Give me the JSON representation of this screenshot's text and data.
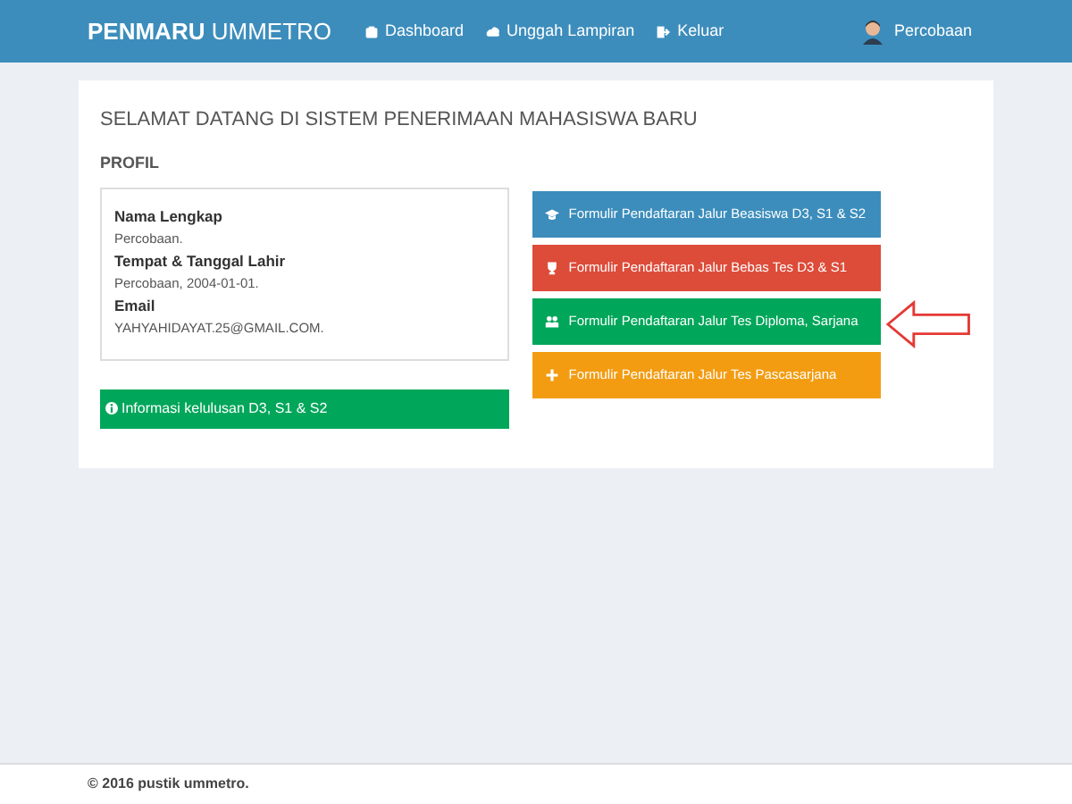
{
  "navbar": {
    "brand": "**PENMARU** UMMETRO",
    "links": [
      {
        "label": "Dashboard",
        "kind": "dashboard"
      },
      {
        "label": "Unggah Lampiran",
        "kind": "upload"
      },
      {
        "label": "Keluar",
        "kind": "logout"
      }
    ],
    "user": "Percobaan"
  },
  "welcome": "SELAMAT DATANG DI SISTEM PENERIMAAN MAHASISWA BARU",
  "profile": {
    "heading": "PROFIL",
    "fields": [
      {
        "label": "Nama Lengkap",
        "value": "Percobaan."
      },
      {
        "label": "Tempat & Tanggal Lahir",
        "value": "Percobaan, 2004-01-01."
      },
      {
        "label": "Email",
        "value": "YAHYAHIDAYAT.25@GMAIL.COM."
      }
    ]
  },
  "info_button": {
    "label": "Informasi kelulusan D3, S1 & S2",
    "color": "#00a65a"
  },
  "forms": [
    {
      "label": "Formulir Pendaftaran Jalur Beasiswa D3, S1 & S2",
      "kind": "graduation",
      "color": "#3c8dbc"
    },
    {
      "label": "Formulir Pendaftaran Jalur Bebas Tes D3 & S1",
      "kind": "trophy",
      "color": "#dd4b39"
    },
    {
      "label": "Formulir Pendaftaran Jalur Tes Diploma, Sarjana",
      "kind": "users",
      "color": "#00a65a"
    },
    {
      "label": "Formulir Pendaftaran Jalur Tes Pascasarjana",
      "kind": "plus",
      "color": "#f39c12"
    }
  ],
  "footer": "© 2016 pustik ummetro."
}
